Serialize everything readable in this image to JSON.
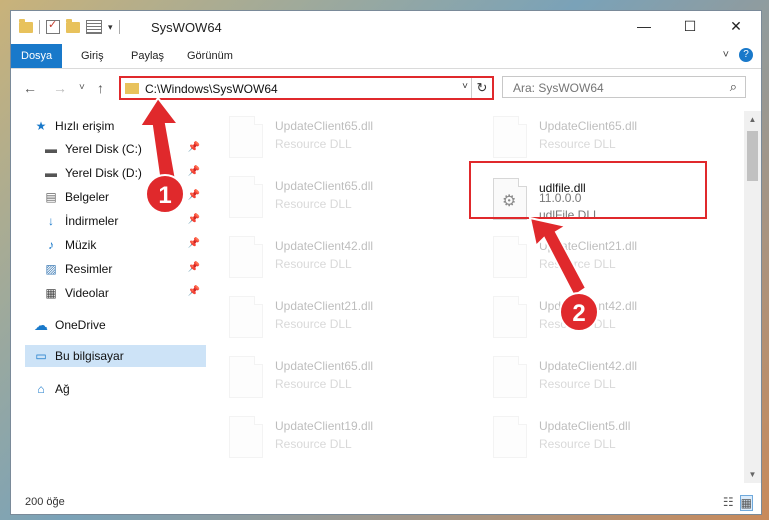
{
  "window": {
    "title": "SysWOW64",
    "controls": {
      "minimize": "—",
      "maximize": "☐",
      "close": "✕"
    }
  },
  "ribbon": {
    "tabs": [
      "Dosya",
      "Giriş",
      "Paylaş",
      "Görünüm"
    ],
    "expand": "˅",
    "help": "?"
  },
  "navbar": {
    "back": "←",
    "forward": "→",
    "recent": "˅",
    "up": "↑",
    "address": "C:\\Windows\\SysWOW64",
    "dropdown": "˅",
    "refresh": "↻",
    "search_placeholder": "Ara: SysWOW64",
    "search_icon": "⌕"
  },
  "sidebar": {
    "items": [
      {
        "label": "Hızlı erişim",
        "icon": "★",
        "pin": ""
      },
      {
        "label": "Yerel Disk (C:)",
        "icon": "▬",
        "pin": "📌"
      },
      {
        "label": "Yerel Disk (D:)",
        "icon": "▬",
        "pin": "📌"
      },
      {
        "label": "Belgeler",
        "icon": "▤",
        "pin": "📌"
      },
      {
        "label": "İndirmeler",
        "icon": "↓",
        "pin": "📌"
      },
      {
        "label": "Müzik",
        "icon": "♪",
        "pin": "📌"
      },
      {
        "label": "Resimler",
        "icon": "▨",
        "pin": "📌"
      },
      {
        "label": "Videolar",
        "icon": "▦",
        "pin": "📌"
      },
      {
        "label": "OneDrive",
        "icon": "☁",
        "pin": ""
      },
      {
        "label": "Bu bilgisayar",
        "icon": "▭",
        "pin": ""
      },
      {
        "label": "Ağ",
        "icon": "⌂",
        "pin": ""
      }
    ]
  },
  "files": {
    "left": [
      {
        "name": "UpdateClient65.dll",
        "desc": "Resource DLL"
      },
      {
        "name": "UpdateClient65.dll",
        "desc": "Resource DLL"
      },
      {
        "name": "UpdateClient42.dll",
        "desc": "Resource DLL"
      },
      {
        "name": "UpdateClient21.dll",
        "desc": "Resource DLL"
      },
      {
        "name": "UpdateClient65.dll",
        "desc": "Resource DLL"
      },
      {
        "name": "UpdateClient19.dll",
        "desc": "Resource DLL"
      }
    ],
    "right": [
      {
        "name": "UpdateClient65.dll",
        "desc": "Resource DLL"
      },
      {
        "name": "udlfile.dll",
        "version": "11.0.0.0",
        "desc": "udlFile DLL"
      },
      {
        "name": "UpdateClient21.dll",
        "desc": "Resource DLL"
      },
      {
        "name": "UpdateClient42.dll",
        "desc": "Resource DLL"
      },
      {
        "name": "UpdateClient42.dll",
        "desc": "Resource DLL"
      },
      {
        "name": "UpdateClient5.dll",
        "desc": "Resource DLL"
      }
    ]
  },
  "status": {
    "count": "200 öğe",
    "details_view": "☷",
    "tiles_view": "▦"
  },
  "annotations": {
    "step1": "1",
    "step2": "2",
    "color": "#e0292c"
  }
}
